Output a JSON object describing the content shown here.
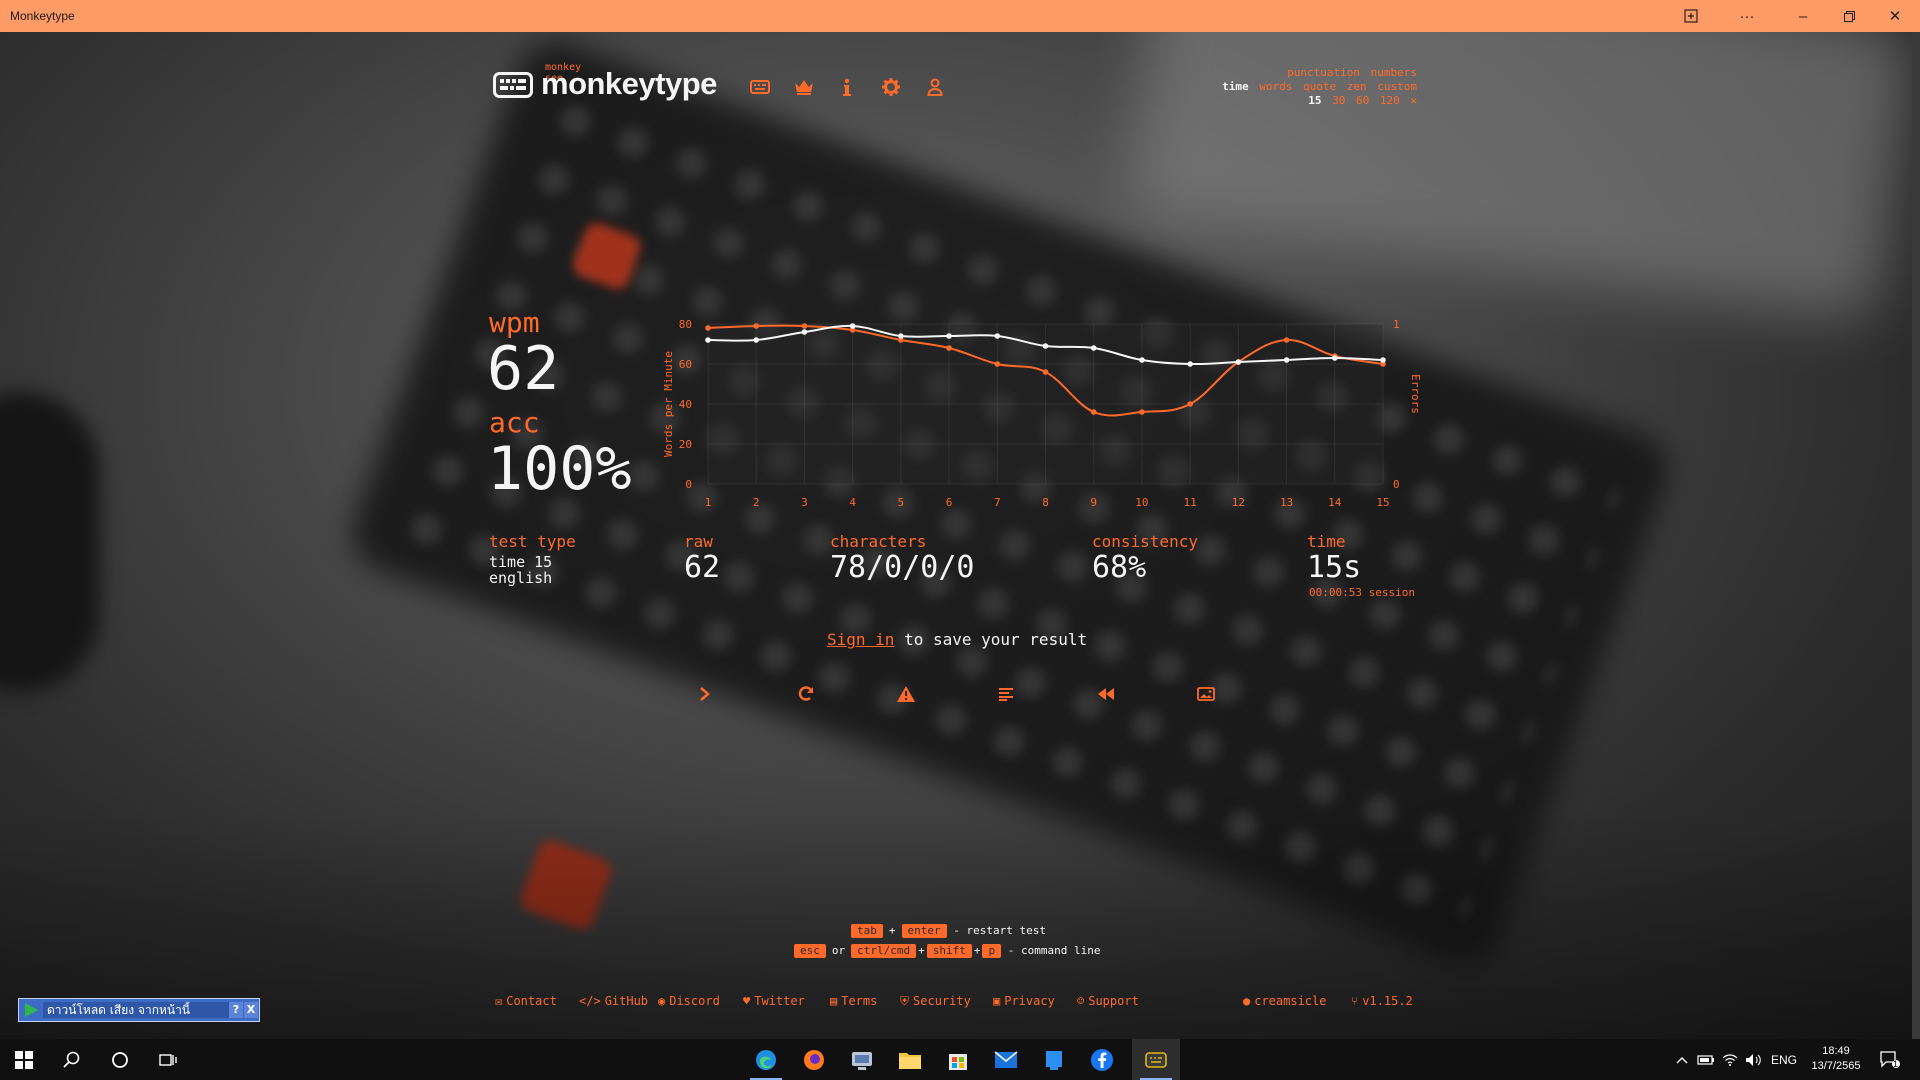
{
  "window": {
    "title": "Monkeytype"
  },
  "header": {
    "logo_sub": "monkey see",
    "logo_text": "monkeytype",
    "nav": [
      "keyboard-icon",
      "crown-icon",
      "info-icon",
      "settings-icon",
      "user-icon"
    ]
  },
  "config": {
    "modifiers": [
      "punctuation",
      "numbers"
    ],
    "modes": [
      "time",
      "words",
      "quote",
      "zen",
      "custom"
    ],
    "active_mode": "time",
    "durations": [
      "15",
      "30",
      "60",
      "120"
    ],
    "active_duration": "15"
  },
  "results": {
    "wpm_label": "wpm",
    "wpm": "62",
    "acc_label": "acc",
    "acc": "100%",
    "test_type_label": "test type",
    "test_type_line1": "time 15",
    "test_type_line2": "english",
    "raw_label": "raw",
    "raw": "62",
    "characters_label": "characters",
    "characters": "78/0/0/0",
    "consistency_label": "consistency",
    "consistency": "68%",
    "time_label": "time",
    "time": "15s",
    "session": "00:00:53 session"
  },
  "signin": {
    "link": "Sign in",
    "text": " to save your result"
  },
  "actions": [
    "next-test",
    "restart",
    "report",
    "words-history",
    "replay",
    "screenshot"
  ],
  "shortcuts": {
    "tab": "tab",
    "plus": "+",
    "enter": "enter",
    "restart_text": "- restart test",
    "esc": "esc",
    "or": "or",
    "ctrl": "ctrl/cmd",
    "shift": "shift",
    "p": "p",
    "command_text": "- command line"
  },
  "footer": {
    "links": [
      "Contact",
      "GitHub",
      "Discord",
      "Twitter",
      "Terms",
      "Security",
      "Privacy",
      "Support"
    ],
    "theme": "creamsicle",
    "version": "v1.15.2"
  },
  "download_widget": {
    "text": "ดาวน์โหลด เสียง จากหน้านี้",
    "help": "?",
    "close": "X"
  },
  "taskbar": {
    "lang": "ENG",
    "time": "18:49",
    "date": "13/7/2565",
    "notifications": "1"
  },
  "colors": {
    "accent": "#ff6a2b",
    "text": "#f5f5f5",
    "titlebar": "#ff9b66"
  },
  "chart_data": {
    "type": "line",
    "x": [
      1,
      2,
      3,
      4,
      5,
      6,
      7,
      8,
      9,
      10,
      11,
      12,
      13,
      14,
      15
    ],
    "series": [
      {
        "values": [
          72,
          72,
          76,
          79,
          74,
          74,
          74,
          69,
          68,
          62,
          60,
          61,
          62,
          63,
          62
        ],
        "color": "#f5f5f5"
      },
      {
        "values": [
          78,
          79,
          79,
          77,
          72,
          68,
          60,
          56,
          36,
          36,
          40,
          61,
          72,
          64,
          60
        ],
        "color": "#ff6a2b"
      }
    ],
    "ylabel": "Words per Minute",
    "y2label": "Errors",
    "y_ticks": [
      "0",
      "20",
      "40",
      "60",
      "80"
    ],
    "y2_ticks": [
      "0",
      "1"
    ],
    "ylim": [
      0,
      80
    ],
    "grid": true
  }
}
